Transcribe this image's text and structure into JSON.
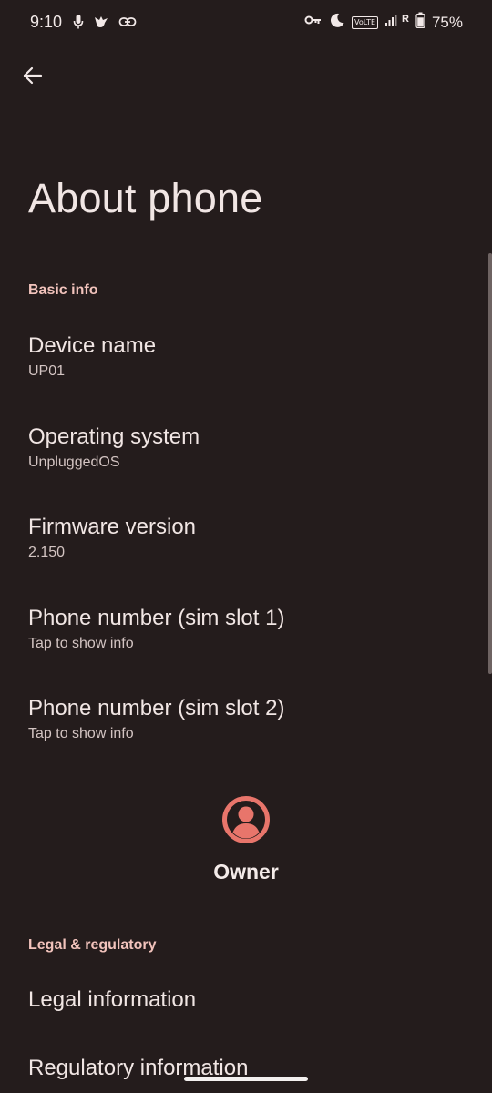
{
  "status_bar": {
    "time": "9:10",
    "network_type": "VoLTE",
    "roaming_indicator": "R",
    "battery_percent": "75%",
    "left_icons": [
      "assistant-mic-icon",
      "notification-bird-icon",
      "link-icon"
    ],
    "right_icons": [
      "vpn-key-icon",
      "do-not-disturb-moon-icon",
      "volte-icon",
      "signal-icon",
      "battery-icon"
    ]
  },
  "header": {
    "title": "About phone",
    "back_icon": "arrow-back-icon"
  },
  "sections": [
    {
      "header": "Basic info",
      "items": [
        {
          "title": "Device name",
          "summary": "UP01"
        },
        {
          "title": "Operating system",
          "summary": "UnpluggedOS"
        },
        {
          "title": "Firmware version",
          "summary": "2.150"
        },
        {
          "title": "Phone number (sim slot 1)",
          "summary": "Tap to show info"
        },
        {
          "title": "Phone number (sim slot 2)",
          "summary": "Tap to show info"
        }
      ]
    },
    {
      "header": "Legal & regulatory",
      "items": [
        {
          "title": "Legal information"
        },
        {
          "title": "Regulatory information"
        }
      ]
    }
  ],
  "owner": {
    "label": "Owner",
    "icon": "account-circle-icon"
  },
  "colors": {
    "background": "#241c1c",
    "accent": "#e8756b",
    "section_header": "#f2c3bc",
    "primary_text": "#f1e6e4",
    "secondary_text": "#d3c4c2"
  }
}
